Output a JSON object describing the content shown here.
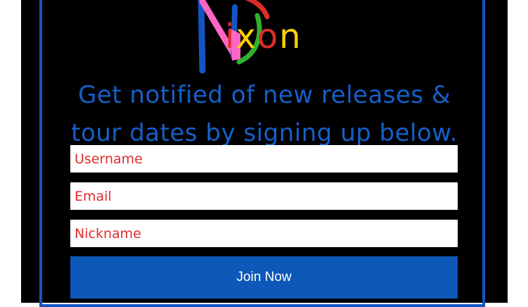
{
  "colors": {
    "page_background": "#ffffff",
    "panel_background": "#000000",
    "frame_border": "#1455c0",
    "headline_text": "#1560c9",
    "placeholder_text": "#e02b2b",
    "button_background": "#0d58b8",
    "button_text": "#ffffff"
  },
  "logo": {
    "letter_colors": [
      "#e02b2b",
      "#ffd400",
      "#e02b2b",
      "#ffd400"
    ],
    "n_stroke_colors": [
      "#1455c0",
      "#ff66c4",
      "#2fb12f",
      "#1455c0"
    ],
    "letters": [
      "i",
      "x",
      "o",
      "n"
    ]
  },
  "headline": "Get notified of new releases & tour dates by signing up below.",
  "form": {
    "username_placeholder": "Username",
    "email_placeholder": "Email",
    "nickname_placeholder": "Nickname",
    "join_label": "Join Now"
  }
}
